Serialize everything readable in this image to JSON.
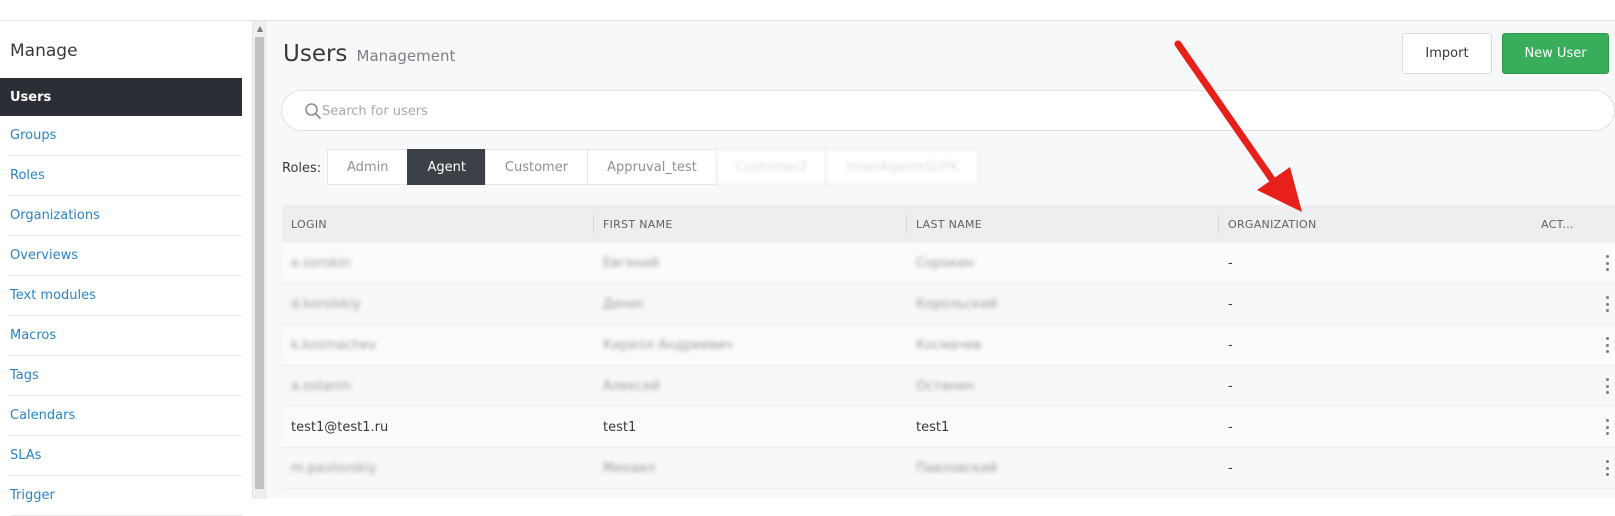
{
  "sidebar": {
    "title": "Manage",
    "items": [
      {
        "label": "Users"
      },
      {
        "label": "Groups"
      },
      {
        "label": "Roles"
      },
      {
        "label": "Organizations"
      },
      {
        "label": "Overviews"
      },
      {
        "label": "Text modules"
      },
      {
        "label": "Macros"
      },
      {
        "label": "Tags"
      },
      {
        "label": "Calendars"
      },
      {
        "label": "SLAs"
      },
      {
        "label": "Trigger"
      }
    ]
  },
  "header": {
    "title": "Users",
    "subtitle": "Management",
    "import_label": "Import",
    "new_user_label": "New User"
  },
  "search": {
    "placeholder": "Search for users"
  },
  "roles": {
    "label": "Roles:",
    "tabs": [
      {
        "label": "Admin"
      },
      {
        "label": "Agent"
      },
      {
        "label": "Customer"
      },
      {
        "label": "Appruval_test"
      },
      {
        "label": "Customer2"
      },
      {
        "label": "InnerAgentsSUPK"
      }
    ],
    "active": "Agent"
  },
  "table": {
    "columns": [
      "LOGIN",
      "FIRST NAME",
      "LAST NAME",
      "ORGANIZATION",
      "ACT..."
    ],
    "rows": [
      {
        "login": "e.sorokin",
        "first": "Евгений",
        "last": "Сорокин",
        "org": "-"
      },
      {
        "login": "d.korolskiy",
        "first": "Денис",
        "last": "Корольский",
        "org": "-"
      },
      {
        "login": "k.kosmachev",
        "first": "Кирилл Андреевич",
        "last": "Космачев",
        "org": "-"
      },
      {
        "login": "a.ostanin",
        "first": "Алексей",
        "last": "Останин",
        "org": "-"
      },
      {
        "login": "test1@test1.ru",
        "first": "test1",
        "last": "test1",
        "org": "-"
      },
      {
        "login": "m.pavlovskiy",
        "first": "Михаил",
        "last": "Павловский",
        "org": "-"
      }
    ]
  },
  "colors": {
    "accent": "#38ae5b",
    "nav_active": "#2b2e35",
    "link": "#2a84c9",
    "annotation_arrow": "#e8201a"
  },
  "icons": [
    "search-icon",
    "more-vertical-icon",
    "scroll-up-arrow-icon"
  ]
}
